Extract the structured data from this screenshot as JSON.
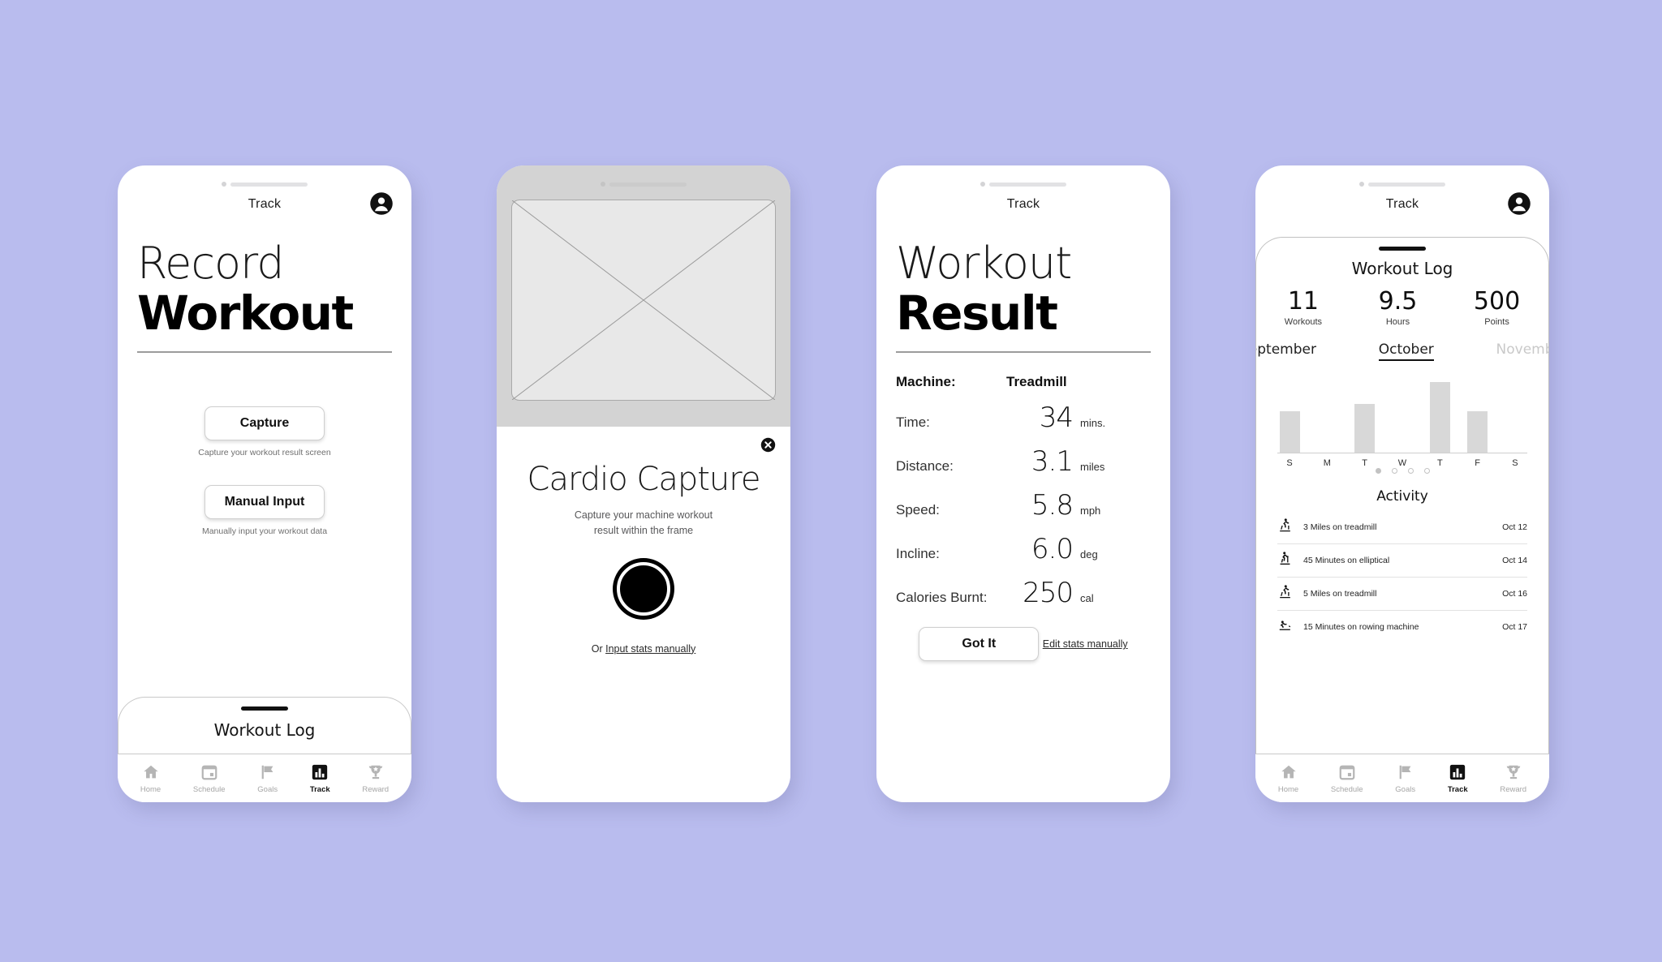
{
  "theme": {
    "background": "#b9bcee",
    "accent": "#000000",
    "muted": "#a6a6a6",
    "bar_fill": "#d8d8d8"
  },
  "tabbar": {
    "items": [
      {
        "label": "Home",
        "icon": "home-icon",
        "active": false
      },
      {
        "label": "Schedule",
        "icon": "calendar-icon",
        "active": false
      },
      {
        "label": "Goals",
        "icon": "flag-icon",
        "active": false
      },
      {
        "label": "Track",
        "icon": "chart-icon",
        "active": true
      },
      {
        "label": "Reward",
        "icon": "trophy-icon",
        "active": false
      }
    ]
  },
  "screen1": {
    "header_title": "Track",
    "avatar_icon": "account-circle-icon",
    "title_line1": "Record",
    "title_line2": "Workout",
    "capture_button": "Capture",
    "capture_caption": "Capture your workout result screen",
    "manual_button": "Manual Input",
    "manual_caption": "Manually input your workout data",
    "sheet_title": "Workout Log"
  },
  "screen2": {
    "viewfinder_placeholder": "image-placeholder",
    "close_icon": "close-circle-icon",
    "title": "Cardio Capture",
    "subtitle_line1": "Capture your machine workout",
    "subtitle_line2": "result within the frame",
    "shutter_icon": "camera-shutter-button",
    "manual_prefix": "Or ",
    "manual_link": "Input stats manually"
  },
  "screen3": {
    "header_title": "Track",
    "title_line1": "Workout",
    "title_line2": "Result",
    "rows": [
      {
        "label": "Machine:",
        "value": "Treadmill",
        "unit": ""
      },
      {
        "label": "Time:",
        "value": "34",
        "unit": "mins."
      },
      {
        "label": "Distance:",
        "value": "3.1",
        "unit": "miles"
      },
      {
        "label": "Speed:",
        "value": "5.8",
        "unit": "mph"
      },
      {
        "label": "Incline:",
        "value": "6.0",
        "unit": "deg"
      },
      {
        "label": "Calories Burnt:",
        "value": "250",
        "unit": "cal"
      }
    ],
    "got_it_button": "Got It",
    "edit_link": "Edit stats manually"
  },
  "screen4": {
    "header_title": "Track",
    "avatar_icon": "account-circle-icon",
    "sheet_title": "Workout Log",
    "stats": [
      {
        "value": "11",
        "caption": "Workouts"
      },
      {
        "value": "9.5",
        "caption": "Hours"
      },
      {
        "value": "500",
        "caption": "Points"
      }
    ],
    "months": [
      {
        "label": "September",
        "active": false,
        "dimmed": false
      },
      {
        "label": "October",
        "active": true,
        "dimmed": false
      },
      {
        "label": "November",
        "active": false,
        "dimmed": true
      }
    ],
    "pagination": {
      "count": 4,
      "active_index": 0
    },
    "activity_title": "Activity",
    "activities": [
      {
        "icon": "treadmill-run-icon",
        "text": "3 Miles on treadmill",
        "date": "Oct 12"
      },
      {
        "icon": "elliptical-icon",
        "text": "45 Minutes on elliptical",
        "date": "Oct 14"
      },
      {
        "icon": "treadmill-run-icon",
        "text": "5 Miles on treadmill",
        "date": "Oct 16"
      },
      {
        "icon": "rowing-machine-icon",
        "text": "15 Minutes on rowing machine",
        "date": "Oct 17"
      }
    ],
    "chart_data": {
      "type": "bar",
      "title": "",
      "categories": [
        "S",
        "M",
        "T",
        "W",
        "T",
        "F",
        "S"
      ],
      "values": [
        55,
        0,
        65,
        0,
        95,
        55,
        0
      ],
      "xlabel": "",
      "ylabel": "",
      "ylim": [
        0,
        100
      ],
      "grid": false,
      "legend": false,
      "bar_color": "#d8d8d8",
      "tick_labels": [
        "S",
        "M",
        "T",
        "W",
        "T",
        "F",
        "S"
      ]
    }
  }
}
